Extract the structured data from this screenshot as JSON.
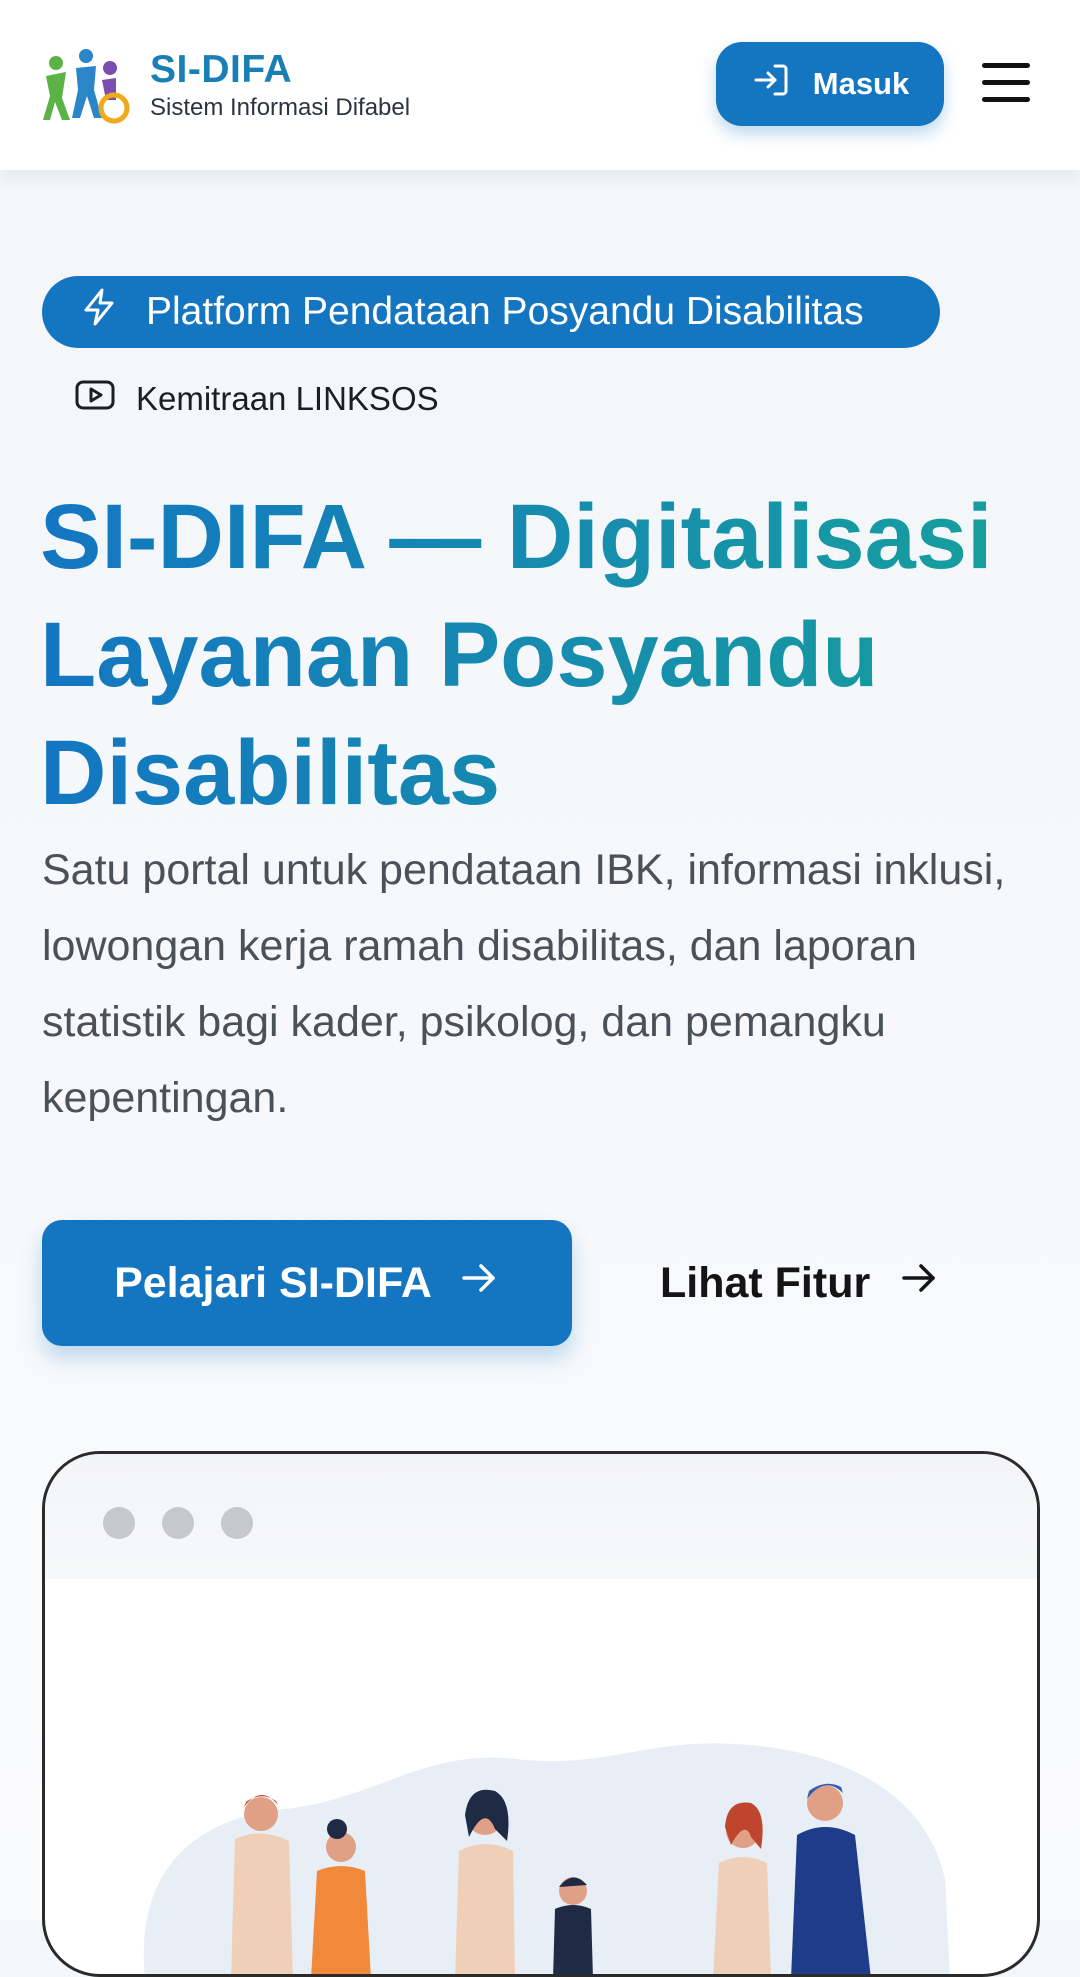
{
  "header": {
    "brand_name": "SI-DIFA",
    "brand_subtitle": "Sistem Informasi Difabel",
    "login_label": "Masuk",
    "icons": [
      "logo-icon",
      "login-icon",
      "menu-icon"
    ]
  },
  "hero": {
    "badge_text": "Platform Pendataan Posyandu Disabilitas",
    "partner_text": "Kemitraan LINKSOS",
    "title": "SI-DIFA — Digitalisasi Layanan Posyandu Disabilitas",
    "description": "Satu portal untuk pendataan IBK, informasi inklusi, lowongan kerja ramah disabilitas, dan laporan statistik bagi kader, psikolog, dan pemangku kepentingan.",
    "primary_cta": "Pelajari SI-DIFA",
    "secondary_cta": "Lihat Fitur"
  },
  "colors": {
    "primary": "#1475c1",
    "teal": "#17a09b",
    "text_muted": "#4b5158"
  }
}
